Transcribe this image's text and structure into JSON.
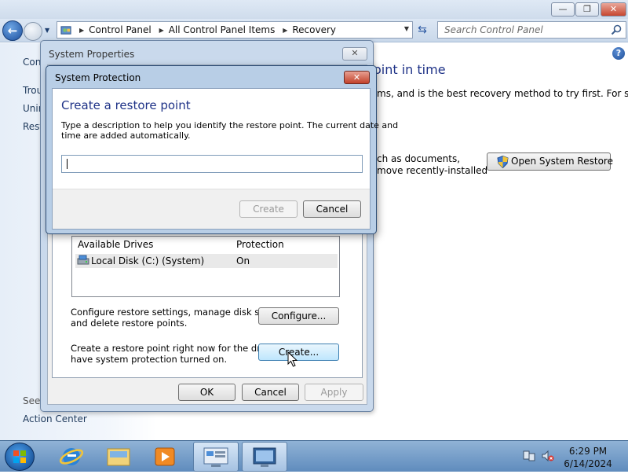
{
  "explorer": {
    "breadcrumbs": [
      "Control Panel",
      "All Control Panel Items",
      "Recovery"
    ],
    "search_placeholder": "Search Control Panel",
    "side_links": [
      "Cont",
      "Trou",
      "Unin",
      "Rest"
    ],
    "see_also": "See",
    "action_center": "Action Center",
    "heading_fragment": "oint in time",
    "text_line1": "ms, and is the best recovery method to try first. For serious",
    "text_line2": "ch as documents,",
    "text_line3": "move recently-installed",
    "open_restore_label": "Open System Restore"
  },
  "sysprops": {
    "title": "System Properties",
    "close_label": "✕",
    "drives_headers": [
      "Available Drives",
      "Protection"
    ],
    "drives": [
      {
        "name": "Local Disk (C:) (System)",
        "protection": "On"
      }
    ],
    "configure_text": [
      "Configure restore settings, manage disk space,",
      "and delete restore points."
    ],
    "configure_label": "Configure...",
    "create_text": [
      "Create a restore point right now for the drives that",
      "have system protection turned on."
    ],
    "create_label": "Create...",
    "ok_label": "OK",
    "cancel_label": "Cancel",
    "apply_label": "Apply"
  },
  "protect": {
    "title": "System Protection",
    "close_label": "✕",
    "heading": "Create a restore point",
    "desc": [
      "Type a description to help you identify the restore point. The current date and",
      "time are added automatically."
    ],
    "input_value": "",
    "create_label": "Create",
    "cancel_label": "Cancel"
  },
  "taskbar": {
    "time": "6:29 PM",
    "date": "6/14/2024"
  },
  "colors": {
    "heading_blue": "#1e3287",
    "link_blue": "#1e395b",
    "taskbar": "#6f99c6"
  },
  "icons": [
    "back-arrow-icon",
    "forward-arrow-icon",
    "control-panel-icon",
    "refresh-icon",
    "search-icon",
    "help-icon",
    "shield-icon",
    "disk-icon",
    "cursor-icon",
    "start-orb-icon",
    "ie-icon",
    "explorer-folder-icon",
    "media-player-icon",
    "system-properties-icon",
    "network-icon",
    "speaker-muted-icon"
  ]
}
